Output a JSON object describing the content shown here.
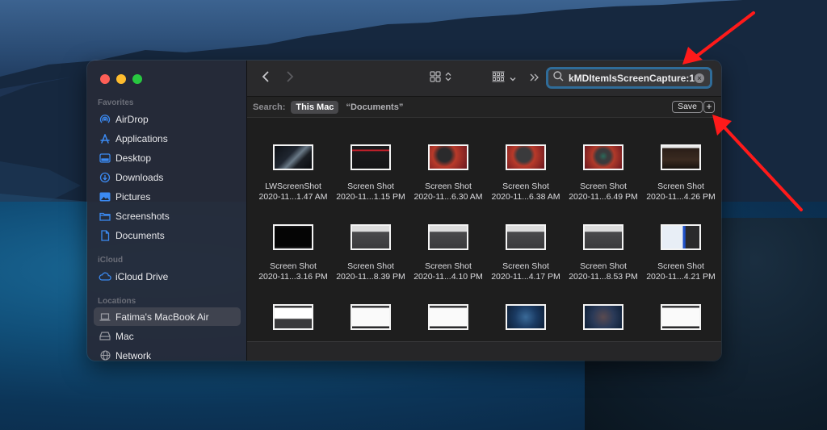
{
  "colors": {
    "accent": "#3b8af2",
    "search_focus_ring": "#2f6c99",
    "annotation_arrow": "#ff1a1a",
    "traffic_close": "#fe5f57",
    "traffic_minimize": "#febc2e",
    "traffic_maximize": "#28c840"
  },
  "sidebar": {
    "sections": [
      {
        "title": "Favorites",
        "items": [
          {
            "label": "AirDrop",
            "icon": "airdrop-icon"
          },
          {
            "label": "Applications",
            "icon": "applications-icon"
          },
          {
            "label": "Desktop",
            "icon": "desktop-icon"
          },
          {
            "label": "Downloads",
            "icon": "downloads-icon"
          },
          {
            "label": "Pictures",
            "icon": "pictures-icon"
          },
          {
            "label": "Screenshots",
            "icon": "folder-icon"
          },
          {
            "label": "Documents",
            "icon": "document-icon"
          }
        ]
      },
      {
        "title": "iCloud",
        "items": [
          {
            "label": "iCloud Drive",
            "icon": "cloud-icon"
          }
        ]
      },
      {
        "title": "Locations",
        "items": [
          {
            "label": "Fatima's MacBook Air",
            "icon": "laptop-icon",
            "selected": true
          },
          {
            "label": "Mac",
            "icon": "drive-icon"
          },
          {
            "label": "Network",
            "icon": "network-icon"
          }
        ]
      }
    ]
  },
  "toolbar": {
    "back_icon": "chevron-left-icon",
    "forward_icon": "chevron-right-icon",
    "view_icon": "icon-grid-view-icon",
    "group_icon": "group-by-icon",
    "more_icon": "overflow-chevrons-icon",
    "search": {
      "value": "kMDItemIsScreenCapture:1",
      "icon": "search-icon",
      "clear_icon": "clear-icon"
    }
  },
  "scope_bar": {
    "label": "Search:",
    "options": [
      "This Mac",
      "“Documents”"
    ],
    "selected": "This Mac",
    "save_label": "Save",
    "add_label": "+"
  },
  "files": [
    {
      "name": "LWScreenShot",
      "date": "2020-11...1.47 AM",
      "thumb": "dark-photo"
    },
    {
      "name": "Screen Shot",
      "date": "2020-11...1.15 PM",
      "thumb": "dark-red-header"
    },
    {
      "name": "Screen Shot",
      "date": "2020-11...6.30 AM",
      "thumb": "red-scene"
    },
    {
      "name": "Screen Shot",
      "date": "2020-11...6.38 AM",
      "thumb": "red-scene-dialog"
    },
    {
      "name": "Screen Shot",
      "date": "2020-11...6.49 PM",
      "thumb": "red-scene-dialog-green"
    },
    {
      "name": "Screen Shot",
      "date": "2020-11...4.26 PM",
      "thumb": "dark-brown"
    },
    {
      "name": "Screen Shot",
      "date": "2020-11...3.16 PM",
      "thumb": "black"
    },
    {
      "name": "Screen Shot",
      "date": "2020-11...8.39 PM",
      "thumb": "light-list"
    },
    {
      "name": "Screen Shot",
      "date": "2020-11...4.10 PM",
      "thumb": "light-list"
    },
    {
      "name": "Screen Shot",
      "date": "2020-11...4.17 PM",
      "thumb": "light-list"
    },
    {
      "name": "Screen Shot",
      "date": "2020-11...8.53 PM",
      "thumb": "light-list"
    },
    {
      "name": "Screen Shot",
      "date": "2020-11...4.21 PM",
      "thumb": "blue-panel"
    },
    {
      "name": "",
      "date": "",
      "thumb": "white-doc-dark"
    },
    {
      "name": "",
      "date": "",
      "thumb": "white-doc"
    },
    {
      "name": "",
      "date": "",
      "thumb": "white-doc"
    },
    {
      "name": "",
      "date": "",
      "thumb": "blue-desktop"
    },
    {
      "name": "",
      "date": "",
      "thumb": "blue-desktop-grid"
    },
    {
      "name": "",
      "date": "",
      "thumb": "white-doc"
    }
  ]
}
